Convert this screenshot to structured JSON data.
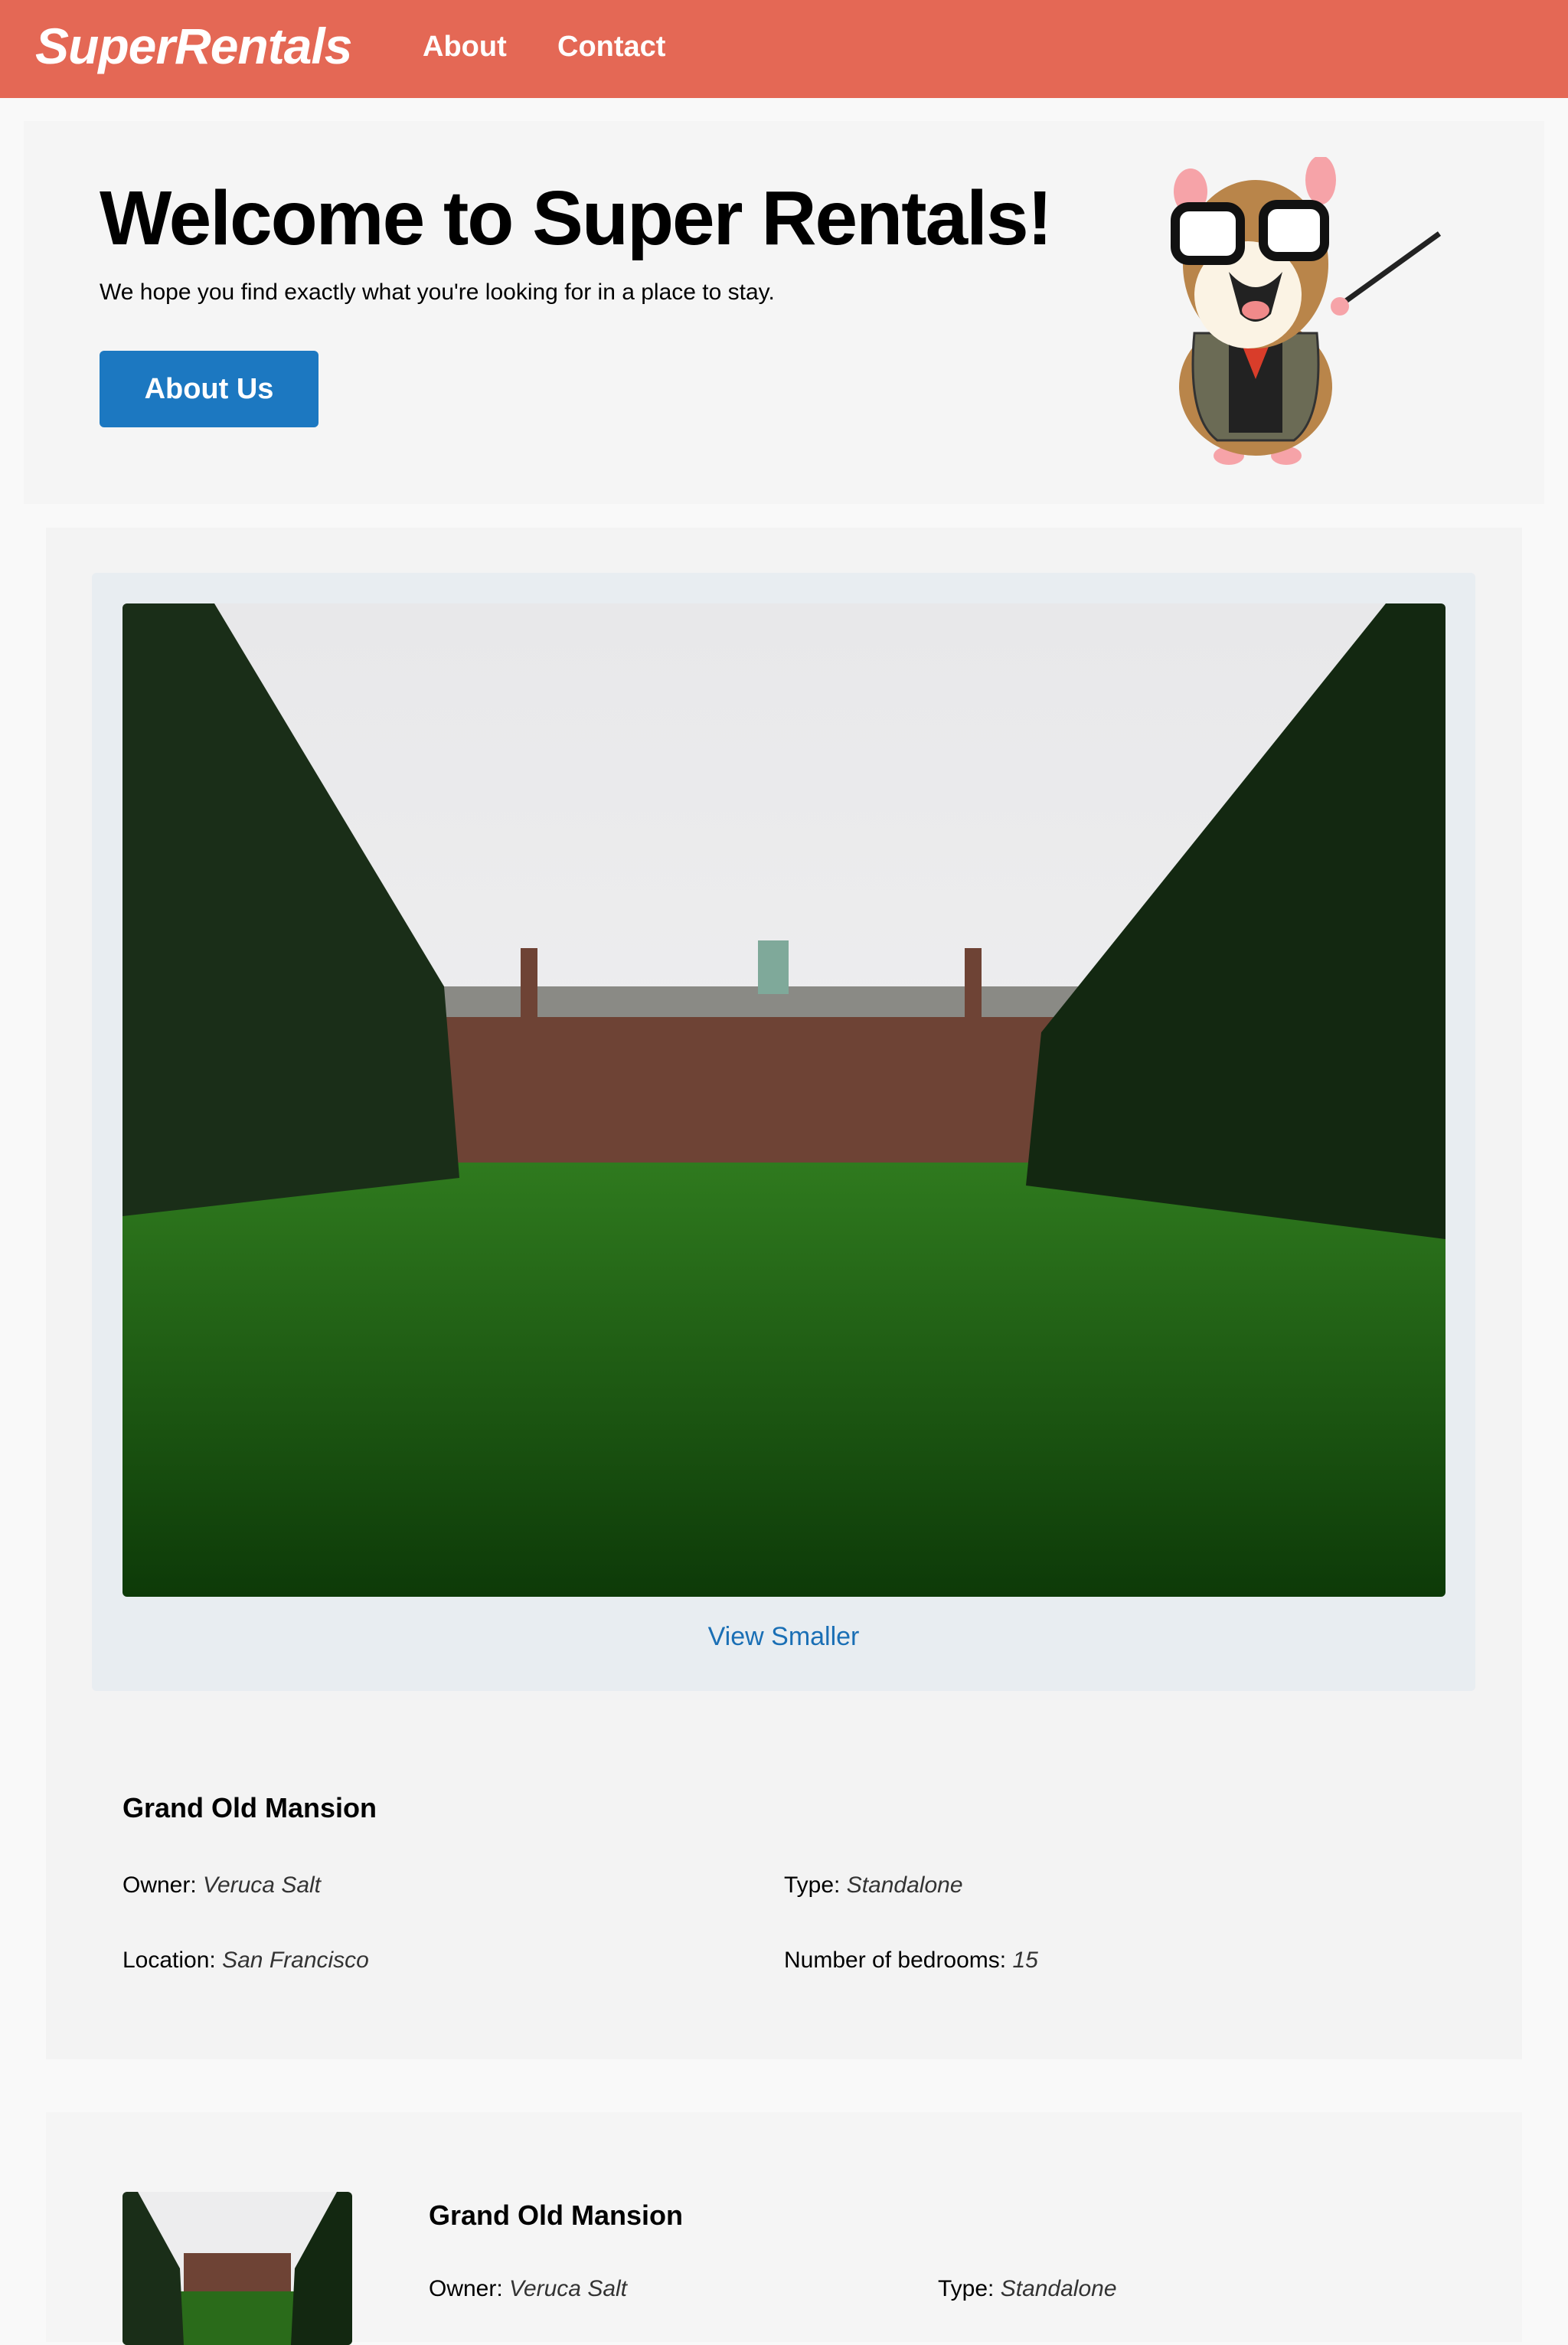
{
  "header": {
    "logo": "SuperRentals",
    "nav": [
      "About",
      "Contact"
    ]
  },
  "jumbo": {
    "title": "Welcome to Super Rentals!",
    "subtitle": "We hope you find exactly what you're looking for in a place to stay.",
    "button": "About Us"
  },
  "rentals": [
    {
      "title": "Grand Old Mansion",
      "owner_label": "Owner:",
      "owner": "Veruca Salt",
      "type_label": "Type:",
      "type": "Standalone",
      "location_label": "Location:",
      "location": "San Francisco",
      "bedrooms_label": "Number of bedrooms:",
      "bedrooms": "15",
      "image_toggle": "View Smaller"
    },
    {
      "title": "Grand Old Mansion",
      "owner_label": "Owner:",
      "owner": "Veruca Salt",
      "type_label": "Type:",
      "type": "Standalone"
    }
  ],
  "colors": {
    "header": "#e46855",
    "button": "#1c78c1",
    "link": "#1a6fb5"
  }
}
